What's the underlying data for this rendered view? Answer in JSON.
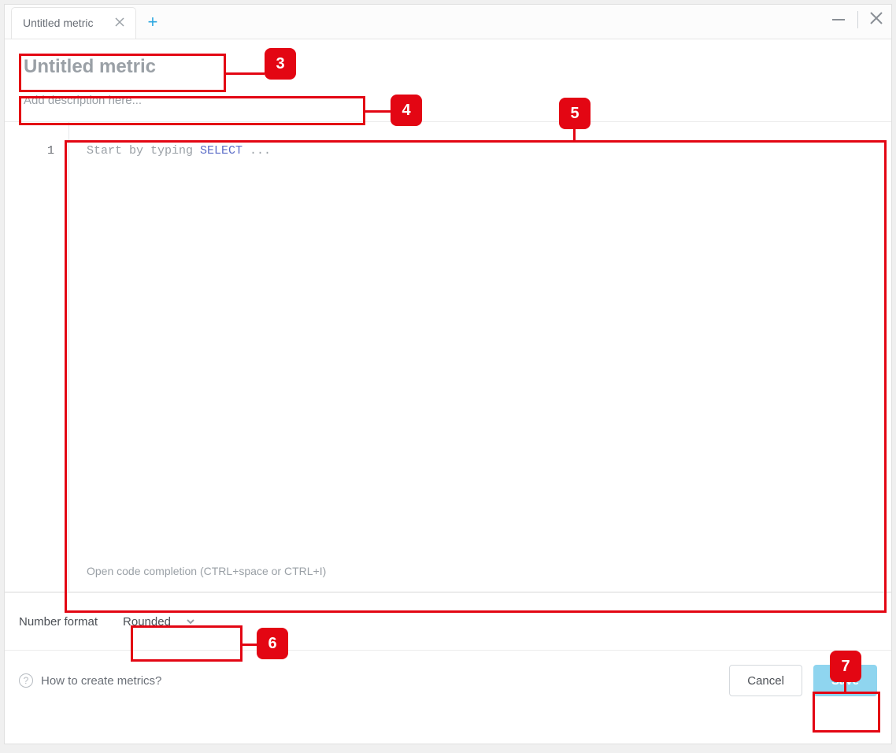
{
  "tab": {
    "label": "Untitled metric"
  },
  "header": {
    "title_placeholder": "Untitled metric",
    "description_placeholder": "Add description here..."
  },
  "editor": {
    "line_number": "1",
    "placeholder_prefix": "Start by typing ",
    "placeholder_keyword": "SELECT",
    "placeholder_suffix": " ...",
    "completion_hint": "Open code completion (CTRL+space or CTRL+I)"
  },
  "format": {
    "label": "Number format",
    "selected": "Rounded"
  },
  "footer": {
    "help_text": "How to create metrics?",
    "cancel_label": "Cancel",
    "save_label": "Save"
  },
  "callouts": {
    "c3": "3",
    "c4": "4",
    "c5": "5",
    "c6": "6",
    "c7": "7"
  }
}
